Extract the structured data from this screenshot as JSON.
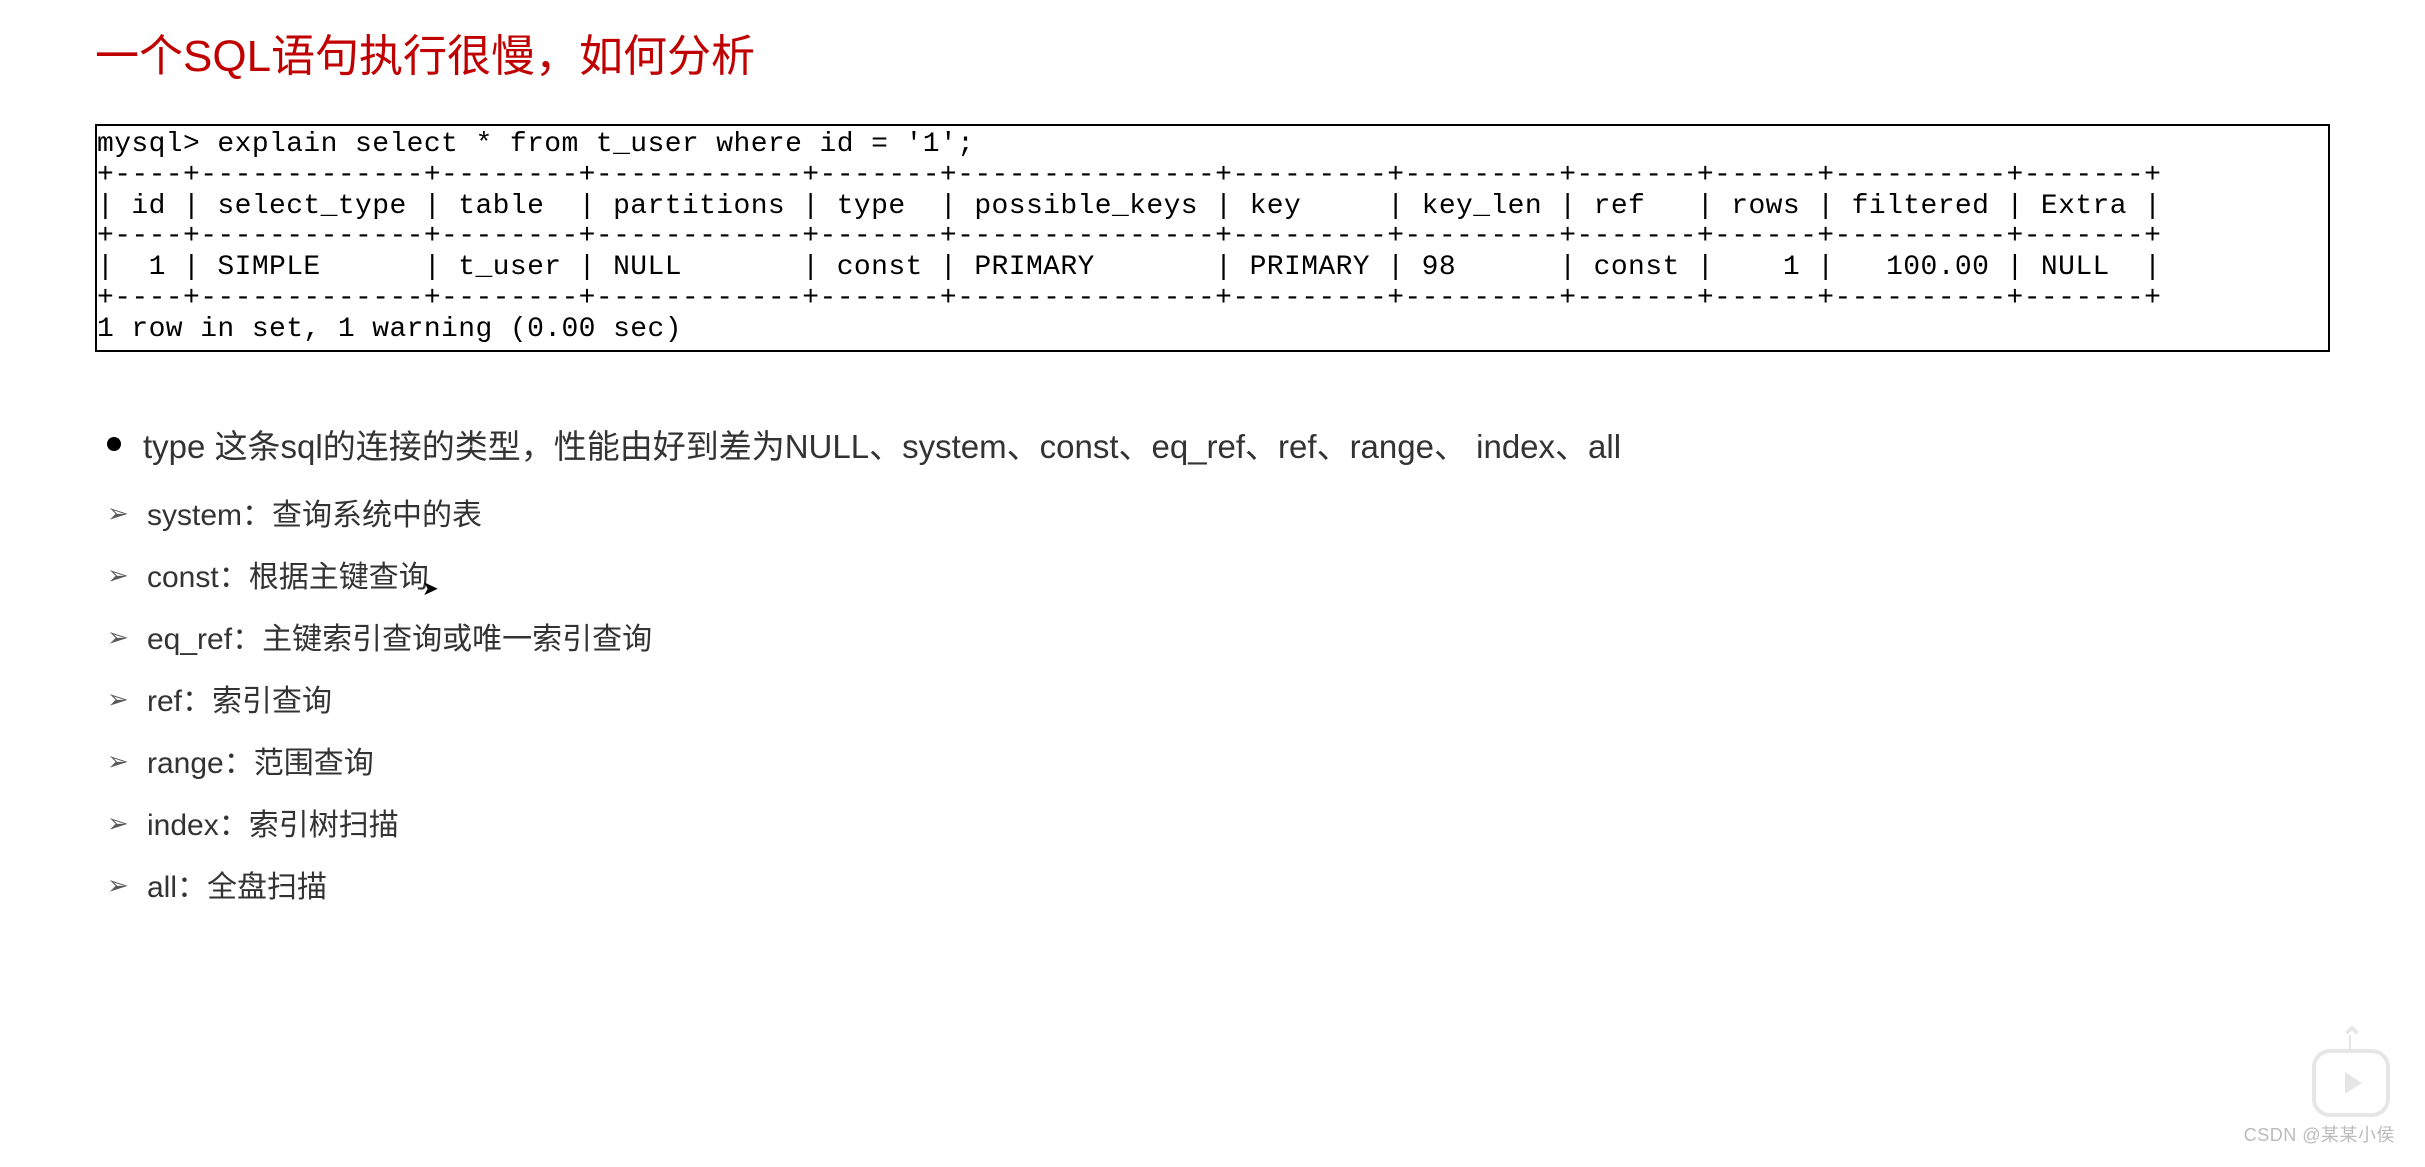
{
  "title": "一个SQL语句执行很慢，如何分析",
  "sql_output": "mysql> explain select * from t_user where id = '1';\n+----+-------------+--------+------------+-------+---------------+---------+---------+-------+------+----------+-------+\n| id | select_type | table  | partitions | type  | possible_keys | key     | key_len | ref   | rows | filtered | Extra |\n+----+-------------+--------+------------+-------+---------------+---------+---------+-------+------+----------+-------+\n|  1 | SIMPLE      | t_user | NULL       | const | PRIMARY       | PRIMARY | 98      | const |    1 |   100.00 | NULL  |\n+----+-------------+--------+------------+-------+---------------+---------+---------+-------+------+----------+-------+\n1 row in set, 1 warning (0.00 sec)",
  "main_bullet": "type 这条sql的连接的类型，性能由好到差为NULL、system、const、eq_ref、ref、range、 index、all",
  "sub_bullets": [
    "system：查询系统中的表",
    "const：根据主键查询",
    "eq_ref：主键索引查询或唯一索引查询",
    "ref：索引查询",
    "range：范围查询",
    "index：索引树扫描",
    "all：全盘扫描"
  ],
  "watermark": "CSDN @某某小侯"
}
